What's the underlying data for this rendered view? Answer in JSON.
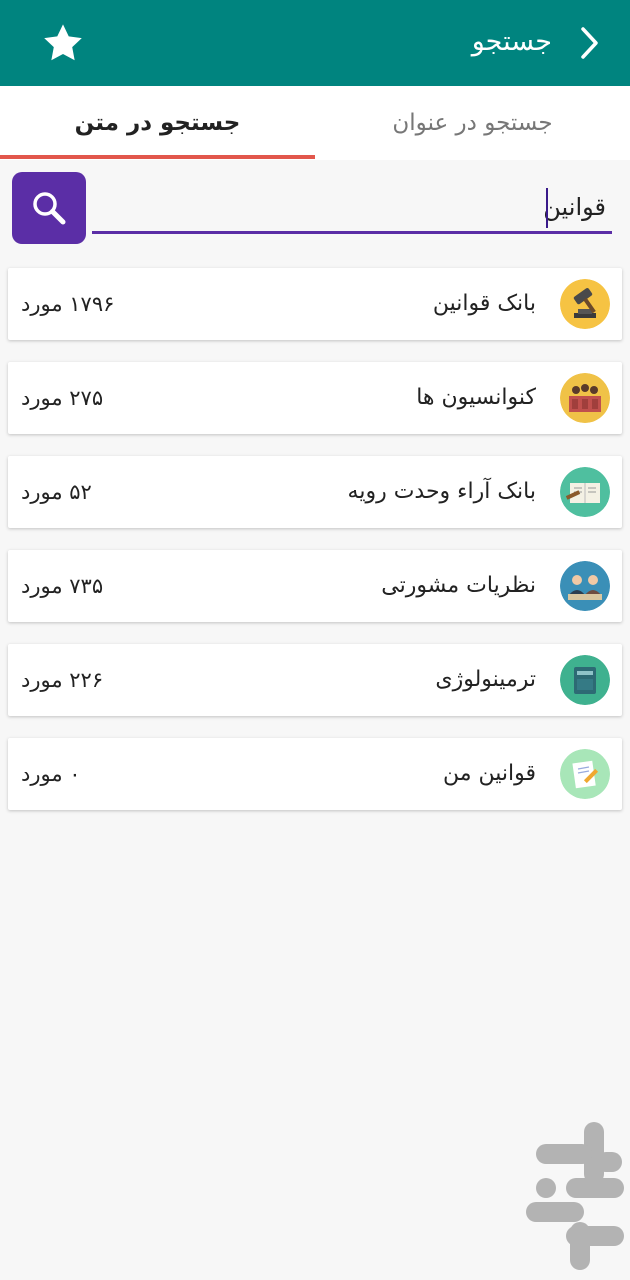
{
  "header": {
    "title": "جستجو",
    "back_icon": "chevron-right-icon",
    "favorite_icon": "star-icon",
    "color": "#00847f"
  },
  "tabs": [
    {
      "label": "جستجو در عنوان",
      "selected": false
    },
    {
      "label": "جستجو در متن",
      "selected": true
    }
  ],
  "search": {
    "value": "قوانین",
    "button_icon": "search-icon",
    "accent": "#5b2ea6"
  },
  "results": [
    {
      "label": "بانک قوانین",
      "count": "۱۷۹۶ مورد",
      "icon": "gavel-icon"
    },
    {
      "label": "کنوانسیون ها",
      "count": "۲۷۵ مورد",
      "icon": "assembly-icon"
    },
    {
      "label": "بانک آراء وحدت رویه",
      "count": "۵۲ مورد",
      "icon": "book-gavel-icon"
    },
    {
      "label": "نظریات مشورتی",
      "count": "۷۳۵ مورد",
      "icon": "consultants-icon"
    },
    {
      "label": "ترمینولوژی",
      "count": "۲۲۶ مورد",
      "icon": "dictionary-icon"
    },
    {
      "label": "قوانین من",
      "count": "۰ مورد",
      "icon": "notes-pencil-icon"
    }
  ],
  "watermark_icon": "store-logo-icon"
}
